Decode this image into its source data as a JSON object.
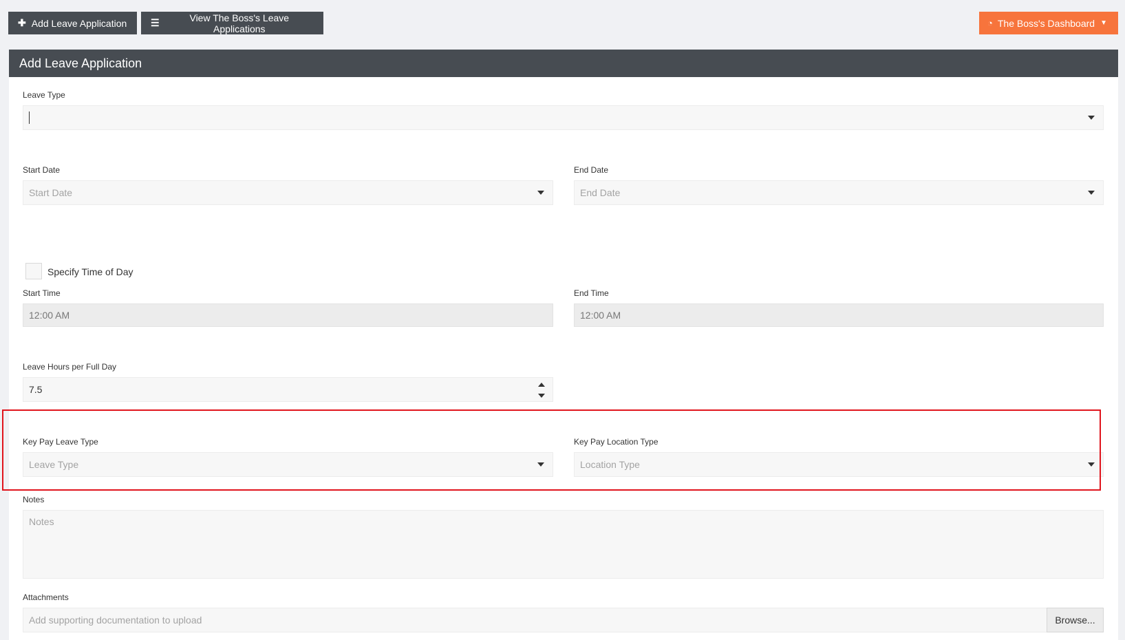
{
  "toolbar": {
    "add_label": "Add Leave Application",
    "view_label": "View The Boss's Leave Applications",
    "dashboard_label": "The Boss's Dashboard"
  },
  "panel": {
    "title": "Add Leave Application"
  },
  "form": {
    "leave_type": {
      "label": "Leave Type",
      "value": ""
    },
    "start_date": {
      "label": "Start Date",
      "placeholder": "Start Date"
    },
    "end_date": {
      "label": "End Date",
      "placeholder": "End Date"
    },
    "specify_time": {
      "label": "Specify Time of Day",
      "checked": false
    },
    "start_time": {
      "label": "Start Time",
      "value": "12:00 AM"
    },
    "end_time": {
      "label": "End Time",
      "value": "12:00 AM"
    },
    "leave_hours": {
      "label": "Leave Hours per Full Day",
      "value": "7.5"
    },
    "keypay_leave_type": {
      "label": "Key Pay Leave Type",
      "placeholder": "Leave Type"
    },
    "keypay_location_type": {
      "label": "Key Pay Location Type",
      "placeholder": "Location Type"
    },
    "notes": {
      "label": "Notes",
      "placeholder": "Notes"
    },
    "attachments": {
      "label": "Attachments",
      "placeholder": "Add supporting documentation to upload",
      "browse_label": "Browse..."
    }
  },
  "colors": {
    "dark_bar": "#474c52",
    "accent_orange": "#f7743c",
    "highlight_red": "#e0141c"
  },
  "icons": {
    "add": "plus-icon",
    "view": "list-icon",
    "dashboard": "dashboard-icon"
  }
}
